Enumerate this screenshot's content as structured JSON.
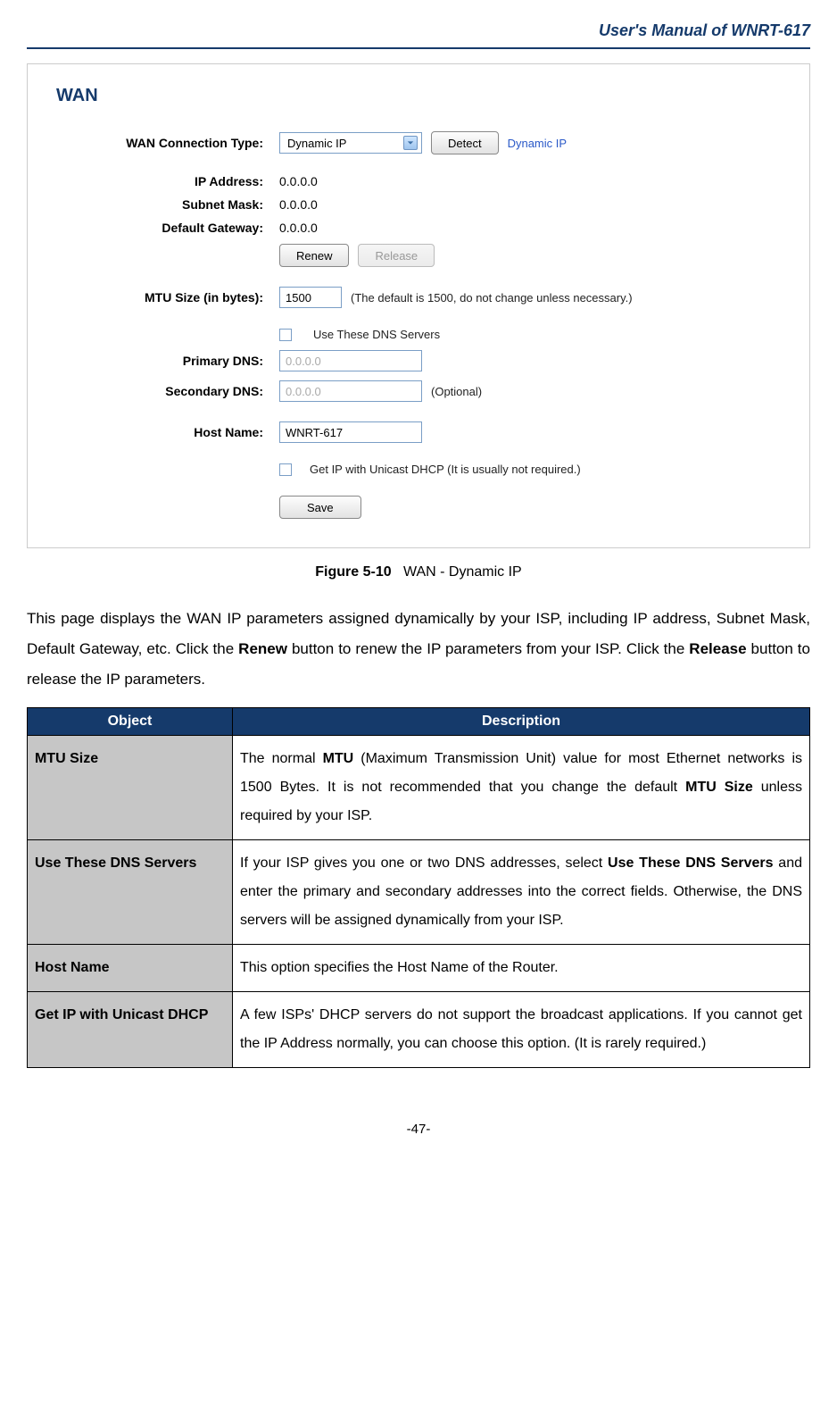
{
  "header": {
    "title": "User's Manual of WNRT-617"
  },
  "wan": {
    "heading": "WAN",
    "connection_type_label": "WAN Connection Type:",
    "connection_type_value": "Dynamic IP",
    "detect_label": "Detect",
    "connection_hint": "Dynamic IP",
    "ip_address_label": "IP Address:",
    "ip_address_value": "0.0.0.0",
    "subnet_mask_label": "Subnet Mask:",
    "subnet_mask_value": "0.0.0.0",
    "default_gateway_label": "Default Gateway:",
    "default_gateway_value": "0.0.0.0",
    "renew_label": "Renew",
    "release_label": "Release",
    "mtu_label": "MTU Size (in bytes):",
    "mtu_value": "1500",
    "mtu_note": "(The default is 1500, do not change unless necessary.)",
    "use_dns_label": "Use These DNS Servers",
    "primary_dns_label": "Primary DNS:",
    "primary_dns_value": "0.0.0.0",
    "secondary_dns_label": "Secondary DNS:",
    "secondary_dns_value": "0.0.0.0",
    "secondary_dns_note": "(Optional)",
    "host_name_label": "Host Name:",
    "host_name_value": "WNRT-617",
    "unicast_label": "Get IP with Unicast DHCP (It is usually not required.)",
    "save_label": "Save"
  },
  "figure": {
    "num": "Figure 5-10",
    "caption": "WAN - Dynamic IP"
  },
  "body": {
    "p1_a": "This page displays the WAN IP parameters assigned dynamically by your ISP, including IP address, Subnet Mask, Default Gateway, etc. Click the ",
    "p1_renew": "Renew",
    "p1_b": " button to renew the IP parameters from your ISP. Click the ",
    "p1_release": "Release",
    "p1_c": " button to release the IP parameters."
  },
  "table": {
    "h_object": "Object",
    "h_desc": "Description",
    "rows": [
      {
        "obj": "MTU Size",
        "d1": "The normal ",
        "d2": "MTU",
        "d3": " (Maximum Transmission Unit) value for most Ethernet networks is 1500 Bytes. It is not recommended that you change the default ",
        "d4": "MTU Size",
        "d5": " unless required by your ISP."
      },
      {
        "obj": "Use These DNS Servers",
        "d1": "If your ISP gives you one or two DNS addresses, select ",
        "d2": "Use These DNS Servers",
        "d3": " and enter the primary and secondary addresses into the correct fields. Otherwise, the DNS servers will be assigned dynamically from your ISP.",
        "d4": "",
        "d5": ""
      },
      {
        "obj": "Host Name",
        "d1": "This option specifies the Host Name of the Router.",
        "d2": "",
        "d3": "",
        "d4": "",
        "d5": ""
      },
      {
        "obj": "Get IP with Unicast DHCP",
        "d1": "A few ISPs' DHCP servers do not support the broadcast applications. If you cannot get the IP Address normally, you can choose this option. (It is rarely required.)",
        "d2": "",
        "d3": "",
        "d4": "",
        "d5": ""
      }
    ]
  },
  "page_number": "-47-"
}
